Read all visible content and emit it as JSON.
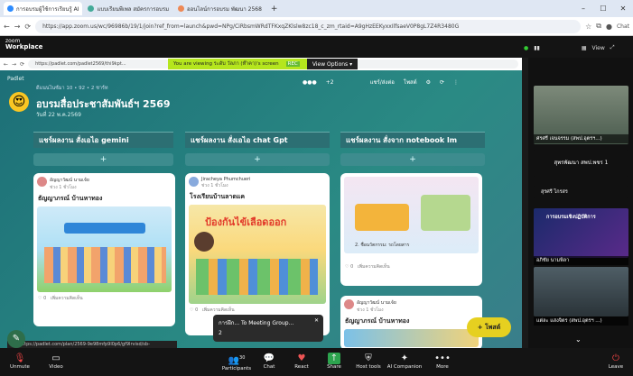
{
  "outer_browser": {
    "tabs": [
      {
        "label": "การอบรมผู้ใช้การเรียนรู้ AI",
        "active": true
      },
      {
        "label": "แบบเรียนพีเพล สมัครการอบรม",
        "active": false
      },
      {
        "label": "ออนไลน์การอบรม พัฒนา 2568",
        "active": false
      }
    ],
    "new_tab": "+",
    "url": "https://app.zoom.us/wc/96986b/19/1/join?ref_from=launch&pwd=NPg/CiRbsmWRdTFKxqZKlslw8zc18_c_zm_rtaid=A9gHzEEKyxxIlfsaeV0P8gL7Z4R3480G",
    "chat_label": "Chat"
  },
  "zoom": {
    "logo_line1": "zoom",
    "logo_line2": "Workplace",
    "view_label": "View"
  },
  "inner_browser": {
    "url": "https://padlet.com/padlet2569/thi9kpt...",
    "viewing_text": "You are viewing  ระดับ วัลภา (ท๊าคา)'s screen",
    "viewing_badge": "REC",
    "view_options": "View Options"
  },
  "padlet": {
    "brand": "Padlet",
    "meta": "ดีแนนไนซ์มา 10 • 92 • 2 ชาร์ท",
    "emoji": "😍",
    "title": "อบรมสื่อประชาสัมพันธ์ฯ 2569",
    "subtitle": "วันที่ 22 พ.ค.2569",
    "tool_count": "+2",
    "tool_share": "แชร์/ส่งต่อ",
    "tool_post": "โพสต์",
    "columns": [
      {
        "header": "แชร์ผลงาน สั่งเอไอ gemini",
        "add": "+"
      },
      {
        "header": "แชร์ผลงาน สั่งเอไอ chat Gpt",
        "add": "+"
      },
      {
        "header": "แชร์ผลงาน สั่งจาก notebook lm",
        "add": "+"
      }
    ],
    "cards": [
      {
        "author": "อัญญาวัฒน์ นามเจ้ย",
        "time": "ช่วง 1 ชั่วโมง",
        "title": "ธัญญาภรณ์ บ้านหาทอง",
        "footer": "เพิ่มความคิดเห็น",
        "likes": "0"
      },
      {
        "author": "Jiracheya Phumchueri",
        "time": "ช่วง 1 ชั่วโมง",
        "title": "โรงเรียนบ้านลาดแค",
        "poster_text": "ป้องกันไข้เลือดออก",
        "footer": "เพิ่มความคิดเห็น",
        "likes": "0"
      },
      {
        "footer": "เพิ่มความคิดเห็น",
        "likes": "0",
        "caption": "2. ชื่อนวัตกรรม: รถโดยสาร"
      },
      {
        "author": "อัญญาวัฒน์ นามเจ้ย",
        "time": "ช่วง 1 ชั่วโมง",
        "title": "ธัญญาภรณ์ บ้านหาทอง"
      }
    ],
    "add_post": "+ โพสต์",
    "status_url": "https://padlet.com/plan/2569-9e98mfp9l0p6/gf9lrvisd/sb-lwdbr94i4/U7K30U3"
  },
  "popup": {
    "line1": "การฝึก... To Meeting Group...",
    "line2": "2"
  },
  "participants": [
    {
      "name": "ศรศรี เจนจรรม (สพป.อุตรฯ...)"
    },
    {
      "name": "สุพรพัฒนา สพป.พชร 1"
    },
    {
      "name": "สุรศรี ไกรสร"
    },
    {
      "name": "อภิชัย นามพิลา"
    },
    {
      "name": "แต่ละ แสงจิตร (สพป.อุตรฯ ...)"
    }
  ],
  "tile_banner": "การอบรมเชิงปฏิบัติการ",
  "toolbar": {
    "unmute": "Unmute",
    "video": "Video",
    "participants": "Participants",
    "participants_count": "30",
    "chat": "Chat",
    "react": "React",
    "share": "Share",
    "host_tools": "Host tools",
    "ai": "AI Companion",
    "more": "More",
    "leave": "Leave"
  }
}
